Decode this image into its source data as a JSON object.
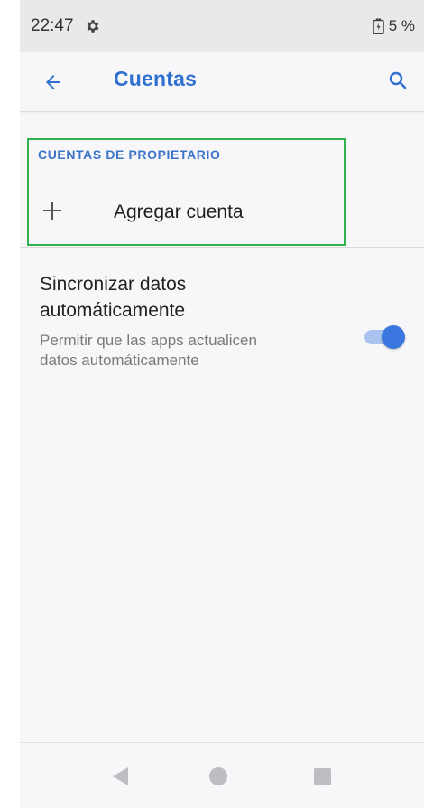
{
  "status_bar": {
    "time": "22:47",
    "battery": "5 %",
    "icons": [
      "gear-icon",
      "battery-icon"
    ]
  },
  "app_bar": {
    "title": "Cuentas",
    "back_icon": "arrow-left-icon",
    "search_icon": "search-icon"
  },
  "owner_accounts": {
    "header": "CUENTAS DE PROPIETARIO",
    "add_account_label": "Agregar cuenta",
    "add_icon": "plus-icon"
  },
  "sync": {
    "title": "Sincronizar datos automáticamente",
    "summary": "Permitir que las apps actualicen datos automáticamente",
    "enabled": true
  },
  "nav_bar": {
    "icons": [
      "nav-back-icon",
      "nav-home-icon",
      "nav-recents-icon"
    ]
  },
  "colors": {
    "accent": "#3071cf",
    "toggle_thumb": "#3a78df",
    "toggle_track": "#a9c3ee",
    "highlight_box": "#2fb34a"
  }
}
